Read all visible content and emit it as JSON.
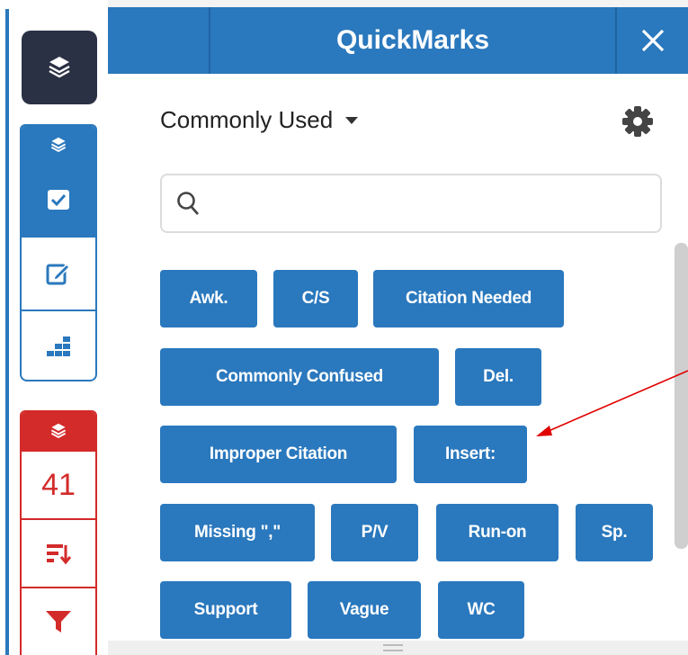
{
  "panel": {
    "title": "QuickMarks",
    "set_label": "Commonly Used",
    "search_placeholder": "",
    "search_value": ""
  },
  "sidebar": {
    "quickmark_count": "41"
  },
  "marks": [
    "Awk.",
    "C/S",
    "Citation Needed",
    "Commonly Confused",
    "Del.",
    "Improper Citation",
    "Insert:",
    "Missing \",\"",
    "P/V",
    "Run-on",
    "Sp.",
    "Support",
    "Vague",
    "WC"
  ],
  "colors": {
    "accent": "#2a78bd",
    "dark": "#2a3144",
    "alert": "#d32a2a",
    "annotation_arrow": "#e00000"
  },
  "icons": [
    "layers-icon",
    "checkbox-icon",
    "edit-icon",
    "grid-icon",
    "sort-icon",
    "filter-icon",
    "close-icon",
    "chevron-down-icon",
    "gear-icon",
    "search-icon"
  ]
}
